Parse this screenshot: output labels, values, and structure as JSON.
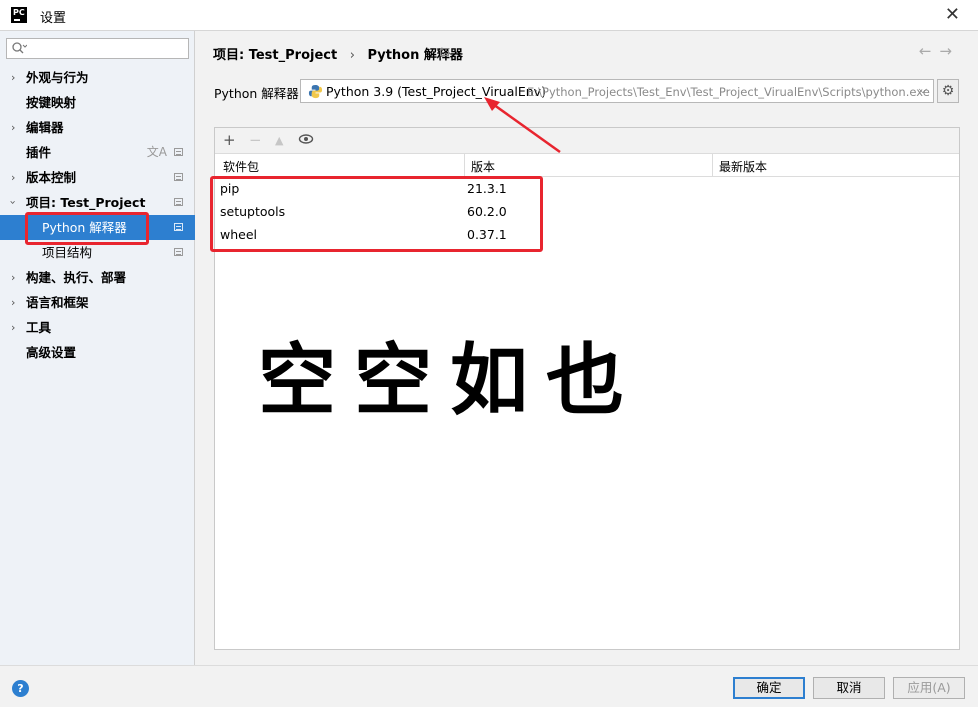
{
  "window": {
    "title": "设置",
    "logo_text": "PC"
  },
  "sidebar": {
    "search_placeholder": "",
    "items": [
      {
        "label": "外观与行为"
      },
      {
        "label": "按键映射"
      },
      {
        "label": "编辑器"
      },
      {
        "label": "插件",
        "icon": "translate-icon"
      },
      {
        "label": "版本控制"
      },
      {
        "label": "项目: Test_Project"
      },
      {
        "label": "Python 解释器",
        "selected": true
      },
      {
        "label": "项目结构"
      },
      {
        "label": "构建、执行、部署"
      },
      {
        "label": "语言和框架"
      },
      {
        "label": "工具"
      },
      {
        "label": "高级设置"
      }
    ]
  },
  "breadcrumb": {
    "project": "项目: Test_Project",
    "separator": "›",
    "page": "Python 解释器"
  },
  "interpreter": {
    "label": "Python 解释器:",
    "name": "Python 3.9 (Test_Project_VirualEnv)",
    "path": "E:\\Python_Projects\\Test_Env\\Test_Project_VirualEnv\\Scripts\\python.exe"
  },
  "packages": {
    "toolbar": {
      "add": "+",
      "remove": "−",
      "upgrade": "▲",
      "show": "👁"
    },
    "columns": [
      "软件包",
      "版本",
      "最新版本"
    ],
    "rows": [
      {
        "name": "pip",
        "version": "21.3.1"
      },
      {
        "name": "setuptools",
        "version": "60.2.0"
      },
      {
        "name": "wheel",
        "version": "0.37.1"
      }
    ]
  },
  "watermark": "空空如也",
  "footer": {
    "help": "?",
    "ok": "确定",
    "cancel": "取消",
    "apply": "应用(A)"
  },
  "colors": {
    "accent": "#2d7fd0",
    "annotation": "#e8252f"
  }
}
